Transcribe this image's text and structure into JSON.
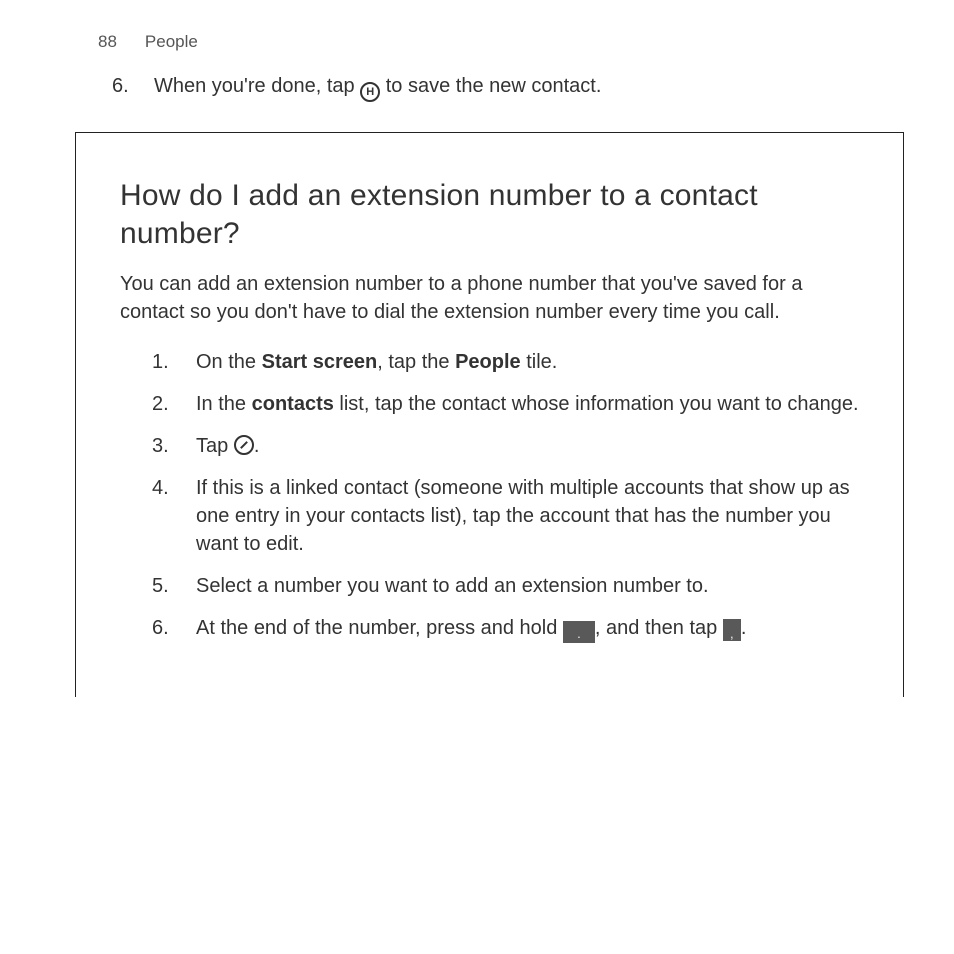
{
  "header": {
    "page_number": "88",
    "section": "People"
  },
  "top_step": {
    "number": "6.",
    "text_before_icon": "When you're done, tap ",
    "text_after_icon": " to save the new contact."
  },
  "box": {
    "title": "How do I add an extension number to a contact number?",
    "intro": "You can add an extension number to a phone number that you've saved for a contact so you don't have to dial the extension number every time you call.",
    "steps": {
      "s1": {
        "pre": "On the ",
        "b1": "Start screen",
        "mid": ", tap the ",
        "b2": "People",
        "post": " tile."
      },
      "s2": {
        "pre": "In the ",
        "b1": "contacts",
        "post": " list, tap the contact whose information you want to change."
      },
      "s3": {
        "pre": "Tap ",
        "post": "."
      },
      "s4": "If this is a linked contact (someone with multiple accounts that show up as one entry in your contacts list), tap the account that has the number you want to edit.",
      "s5": "Select a number you want to add an extension number to.",
      "s6": {
        "pre": "At the end of the number, press and hold ",
        "key1": ".",
        "mid": ", and then tap ",
        "key2": ",",
        "post": "."
      }
    }
  }
}
